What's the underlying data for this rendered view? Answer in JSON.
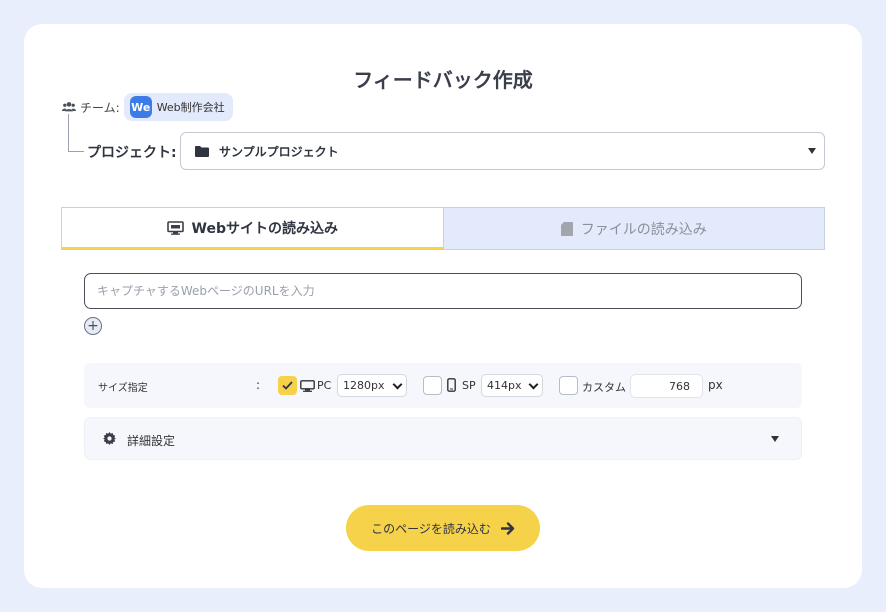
{
  "title": "フィードバック作成",
  "team": {
    "label": "チーム:",
    "avatar_text": "We",
    "name": "Web制作会社"
  },
  "project": {
    "label": "プロジェクト:",
    "value": "サンプルプロジェクト"
  },
  "tabs": [
    {
      "label": "Webサイトの読み込み",
      "active": true
    },
    {
      "label": "ファイルの読み込み",
      "active": false
    }
  ],
  "url_input": {
    "placeholder": "キャプチャするWebページのURLを入力",
    "value": ""
  },
  "add_button": "+",
  "size": {
    "label": "サイズ指定",
    "colon": ":",
    "pc": {
      "label": "PC",
      "checked": true,
      "value": "1280px"
    },
    "sp": {
      "label": "SP",
      "checked": false,
      "value": "414px"
    },
    "custom": {
      "label": "カスタム",
      "checked": false,
      "value": "768",
      "unit": "px"
    }
  },
  "detail": {
    "label": "詳細設定"
  },
  "load_button": {
    "label": "このページを読み込む"
  },
  "colors": {
    "background": "#e8eefc",
    "accent": "#f6d24a",
    "team_avatar": "#3d7ce8",
    "tab_inactive": "#e3eafb"
  }
}
